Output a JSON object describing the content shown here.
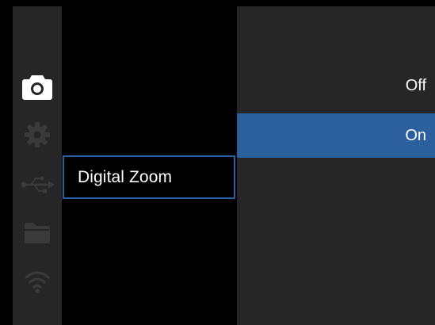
{
  "sidebar": {
    "icons": [
      {
        "name": "camera-icon",
        "active": true
      },
      {
        "name": "gear-icon",
        "active": false
      },
      {
        "name": "usb-icon",
        "active": false
      },
      {
        "name": "folder-icon",
        "active": false
      },
      {
        "name": "wifi-icon",
        "active": false
      }
    ]
  },
  "menu": {
    "selected_item_label": "Digital Zoom"
  },
  "options": {
    "items": [
      {
        "label": "Off",
        "selected": false
      },
      {
        "label": "On",
        "selected": true
      }
    ]
  },
  "colors": {
    "accent": "#2c5f9e",
    "panel": "#262626",
    "icon_active": "#ffffff",
    "icon_inactive": "#3a3a3a"
  }
}
